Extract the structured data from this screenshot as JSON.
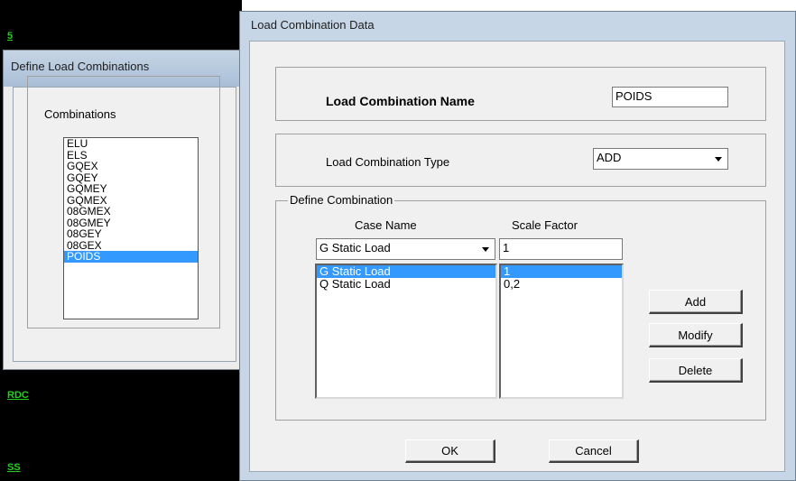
{
  "background": {
    "labels": [
      "5",
      "RDC",
      "SS"
    ]
  },
  "define_dialog": {
    "title": "Define Load Combinations",
    "group_label": "Combinations",
    "combinations": [
      "ELU",
      "ELS",
      "GQEX",
      "GQEY",
      "GQMEY",
      "GQMEX",
      "08GMEX",
      "08GMEY",
      "08GEY",
      "08GEX",
      "POIDS"
    ],
    "selected_index": 10
  },
  "main_dialog": {
    "title": "Load Combination Data",
    "name_label": "Load Combination Name",
    "name_value": "POIDS",
    "type_label": "Load Combination Type",
    "type_value": "ADD",
    "define_group_label": "Define Combination",
    "case_name_header": "Case Name",
    "scale_factor_header": "Scale Factor",
    "case_select_value": "G Static Load",
    "scale_input_value": "1",
    "rows": [
      {
        "case": "G Static Load",
        "factor": "1"
      },
      {
        "case": "Q Static Load",
        "factor": "0,2"
      }
    ],
    "selected_row": 0,
    "add_label": "Add",
    "modify_label": "Modify",
    "delete_label": "Delete",
    "ok_label": "OK",
    "cancel_label": "Cancel"
  },
  "colors": {
    "selection": "#3399ff",
    "title_bar": "#c7d6e7",
    "dialog_face": "#f0f0f0",
    "label_green": "#22d11a"
  }
}
